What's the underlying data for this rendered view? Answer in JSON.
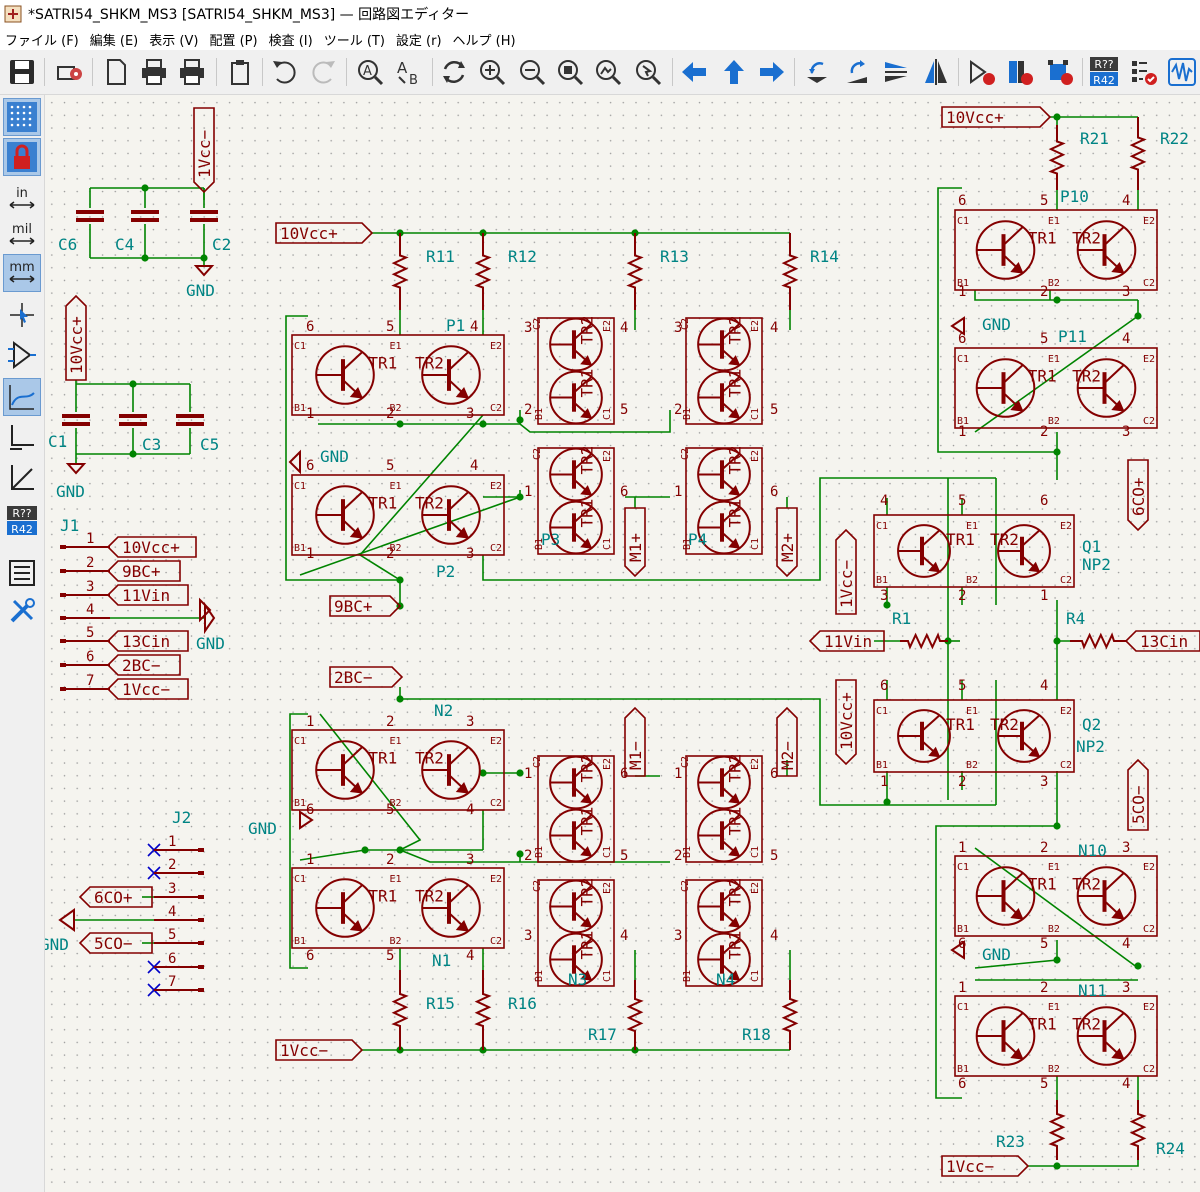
{
  "window": {
    "title": "*SATRI54_SHKM_MS3 [SATRI54_SHKM_MS3] — 回路図エディター"
  },
  "menu": [
    "ファイル (F)",
    "編集 (E)",
    "表示 (V)",
    "配置 (P)",
    "検査 (I)",
    "ツール (T)",
    "設定 (r)",
    "ヘルプ (H)"
  ],
  "toolbar": {
    "tools": [
      "save-icon",
      "schematic-setup-icon",
      "page-settings-icon",
      "print-icon",
      "plot-icon",
      "paste-icon",
      "undo-icon",
      "redo-icon",
      "find-icon",
      "find-replace-icon",
      "refresh-icon",
      "zoom-in-icon",
      "zoom-out-icon",
      "zoom-fit-icon",
      "zoom-objects-icon",
      "zoom-tool-icon",
      "navigate-back-icon",
      "navigate-up-icon",
      "navigate-forward-icon",
      "rotate-ccw-icon",
      "rotate-cw-icon",
      "mirror-v-icon",
      "mirror-h-icon",
      "symbol-editor-icon",
      "symbol-browser-icon",
      "footprint-editor-icon",
      "annotate-icon",
      "erc-icon",
      "simulator-icon"
    ],
    "annotate_text": "R??",
    "annotate_sub": "R42"
  },
  "lefttoolbar": {
    "in": "in",
    "mil": "mil",
    "mm": "mm",
    "annotate_text": "R??",
    "annotate_sub": "R42"
  },
  "colors": {
    "wire": "#008400",
    "symbol": "#840000",
    "label": "#840000",
    "grid": "#848484",
    "net_text": "#008484",
    "junction": "#008400"
  },
  "schematic": {
    "labels": {
      "vccm_top": "1Vcc−",
      "vccp_left": "10Vcc+",
      "vccp_p": "10Vcc+",
      "vccp_top_right": "10Vcc+",
      "vccp_q2": "10Vcc+",
      "vccm_q1": "1Vcc−",
      "vccm_n": "1Vcc−",
      "vccm_br": "1Vcc−",
      "bc9": "9BC+",
      "bc2": "2BC−",
      "vin11": "11Vin",
      "cin13": "13Cin",
      "m1p": "M1+",
      "m2p": "M2+",
      "m1m": "M1−",
      "m2m": "M2−",
      "co6": "6CO+",
      "co5": "5CO−",
      "j2co6": "6CO+",
      "j2co5": "5CO−"
    },
    "gnd": "GND",
    "caps": [
      "C6",
      "C4",
      "C2",
      "C1",
      "C3",
      "C5"
    ],
    "resistors": [
      "R11",
      "R12",
      "R13",
      "R14",
      "R15",
      "R16",
      "R17",
      "R18",
      "R1",
      "R4",
      "R21",
      "R22",
      "R23",
      "R24"
    ],
    "ics": [
      "P1",
      "P2",
      "P3",
      "P4",
      "N1",
      "N2",
      "N3",
      "N4",
      "Q1",
      "Q2",
      "P10",
      "P11",
      "N11",
      "N10"
    ],
    "ic_sub": {
      "np2": "NP2"
    },
    "tr": {
      "tr1": "TR1",
      "tr2": "TR2"
    },
    "pins": {
      "c1": "C1",
      "c2": "C2",
      "e1": "E1",
      "e2": "E2",
      "b1": "B1",
      "b2": "B2"
    },
    "j1": {
      "ref": "J1",
      "pins": [
        "1",
        "2",
        "3",
        "4",
        "5",
        "6",
        "7"
      ],
      "nets": [
        "10Vcc+",
        "9BC+",
        "11Vin",
        "",
        "13Cin",
        "2BC−",
        "1Vcc−"
      ]
    },
    "j2": {
      "ref": "J2",
      "pins": [
        "1",
        "2",
        "3",
        "4",
        "5",
        "6",
        "7"
      ]
    },
    "numbers": {
      "n1": "1",
      "n2": "2",
      "n3": "3",
      "n4": "4",
      "n5": "5",
      "n6": "6"
    }
  }
}
